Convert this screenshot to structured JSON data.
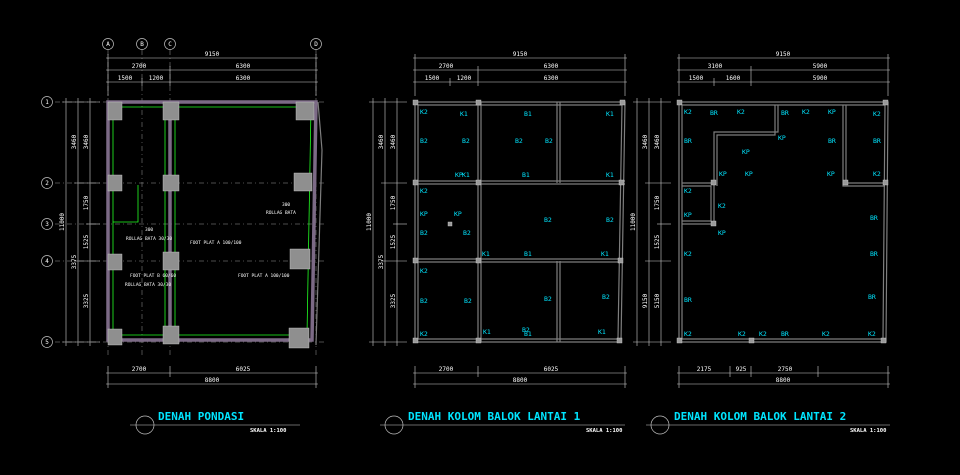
{
  "drawings": {
    "pondasi": {
      "title": "DENAH PONDASI",
      "scale": "SKALA 1:100",
      "grid_x": [
        "A",
        "B",
        "C",
        "D"
      ],
      "grid_y": [
        "1",
        "2",
        "3",
        "4",
        "5"
      ],
      "dims_top": [
        "9150",
        "2700",
        "6300",
        "1500",
        "1200",
        "6300"
      ],
      "dims_left": [
        "11000",
        "3460",
        "3460",
        "1750",
        "1525",
        "3375",
        "3325"
      ],
      "dims_bottom": [
        "2700",
        "6025",
        "8800"
      ],
      "notes": [
        "ROLLAG BATA 30/30",
        "FOOT PLAT A 100/100",
        "FOOT PLAT B 60/60",
        "ROLLAG BATA 30/30",
        "FOOT PLAT A 100/100",
        "ROLLAG BATA",
        "300",
        "300"
      ]
    },
    "lantai1": {
      "title": "DENAH KOLOM BALOK LANTAI 1",
      "scale": "SKALA 1:100",
      "dims_top": [
        "9150",
        "2700",
        "6300",
        "1500",
        "1200",
        "6300"
      ],
      "dims_left": [
        "11000",
        "3460",
        "3460",
        "1750",
        "1525",
        "3375",
        "3325"
      ],
      "dims_bottom": [
        "2700",
        "6025",
        "8800"
      ],
      "labels": [
        "K2",
        "K1",
        "B1",
        "K1",
        "B2",
        "B2",
        "B2",
        "B2",
        "KP",
        "K1",
        "B1",
        "K1",
        "K2",
        "KP",
        "KP",
        "B2",
        "B2",
        "B2",
        "B2",
        "K1",
        "B1",
        "K1",
        "K2",
        "B2",
        "B2",
        "B2",
        "B2",
        "B2",
        "K2",
        "K1",
        "B1",
        "K1"
      ]
    },
    "lantai2": {
      "title": "DENAH KOLOM BALOK LANTAI 2",
      "scale": "SKALA 1:100",
      "dims_top": [
        "9150",
        "3100",
        "5900",
        "1500",
        "1600",
        "5900"
      ],
      "dims_left": [
        "11000",
        "3460",
        "3460",
        "1750",
        "1525",
        "5150",
        "9150"
      ],
      "dims_bottom": [
        "2175",
        "925",
        "2750",
        "8800"
      ],
      "labels": [
        "K2",
        "BR",
        "K2",
        "BR",
        "K2",
        "KP",
        "K2",
        "BR",
        "KP",
        "BR",
        "KP",
        "BR",
        "K2",
        "KP",
        "KP",
        "KP",
        "K2",
        "K2",
        "KP",
        "BR",
        "KP",
        "K2",
        "BR",
        "K2",
        "BR",
        "BR",
        "K2",
        "K2",
        "BR",
        "K2",
        "K2"
      ]
    }
  }
}
